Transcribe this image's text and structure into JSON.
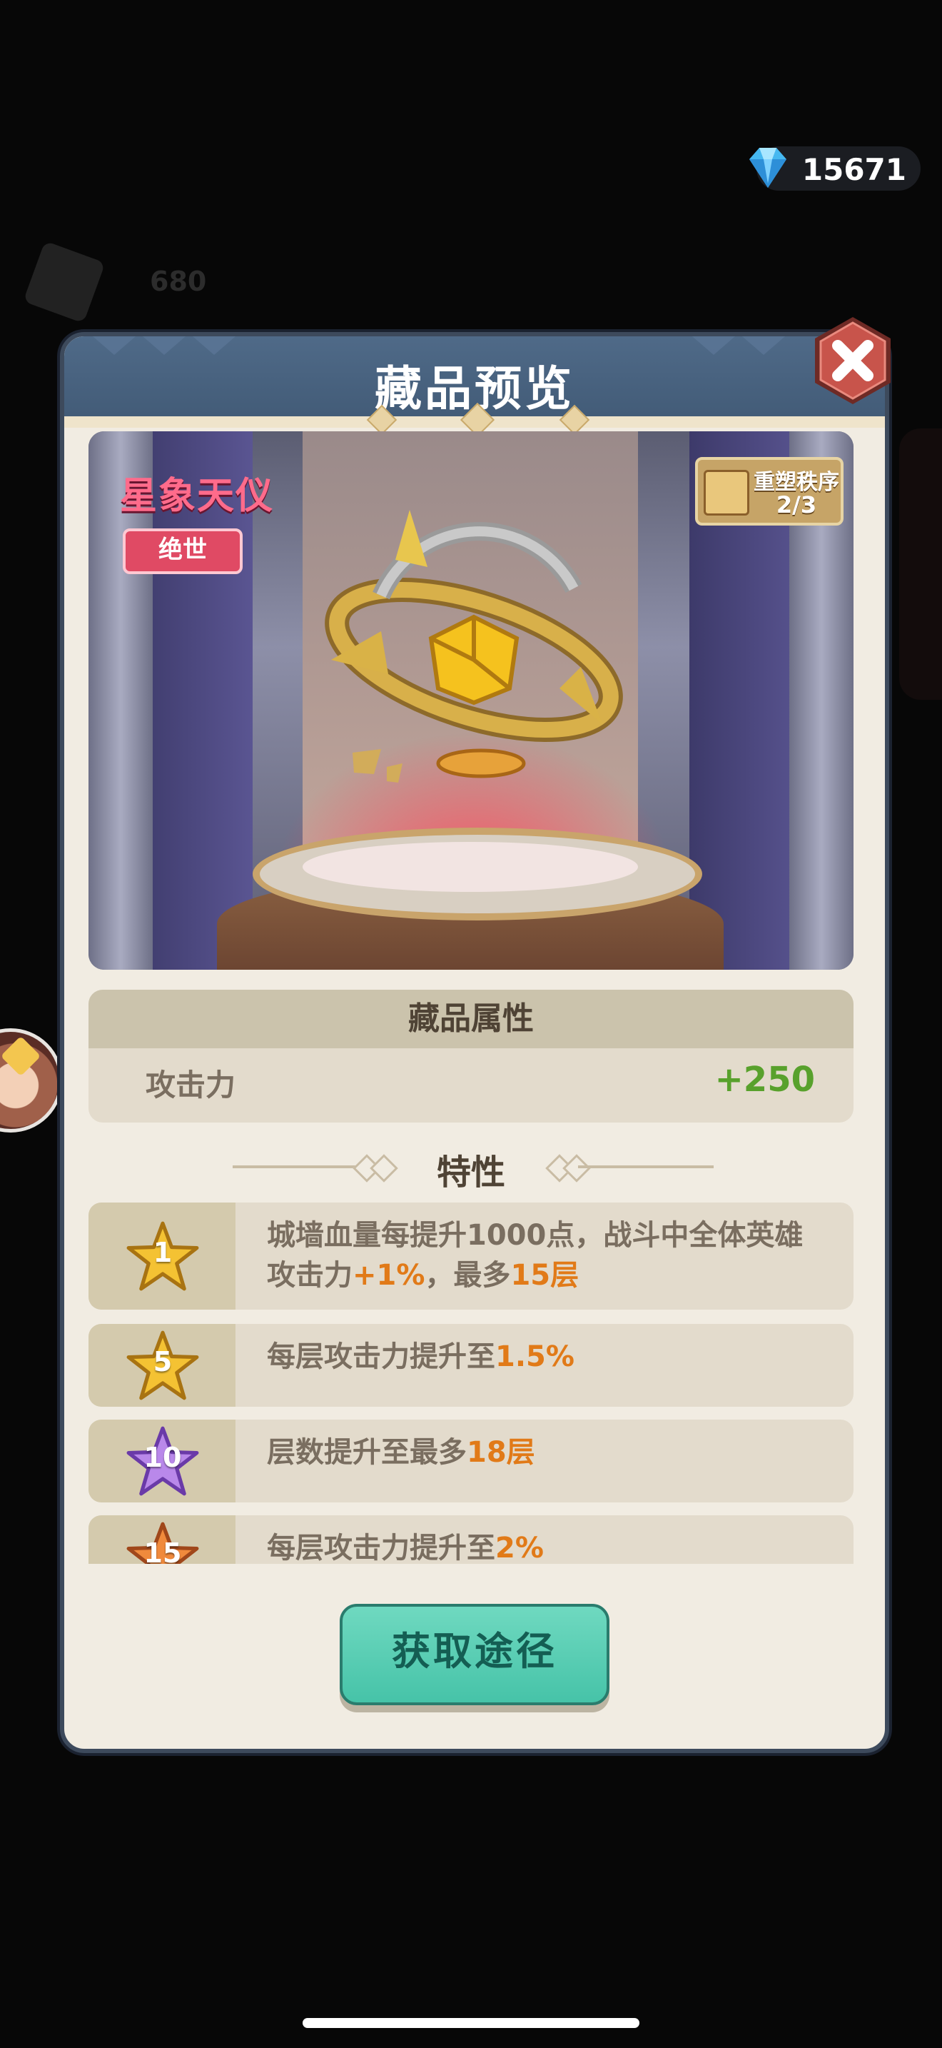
{
  "currency": {
    "icon": "diamond-icon",
    "value": "15671"
  },
  "background": {
    "counter_value": "680"
  },
  "modal": {
    "title": "藏品预览",
    "close_icon": "close-icon"
  },
  "item": {
    "name": "星象天仪",
    "rarity": "绝世",
    "reshape_label": "重塑秩序",
    "reshape_progress": "2/3"
  },
  "attributes": {
    "header": "藏品属性",
    "rows": [
      {
        "name": "攻击力",
        "value": "+250"
      }
    ]
  },
  "traits": {
    "title": "特性",
    "items": [
      {
        "level": "1",
        "star_color": "gold",
        "parts": [
          "城墙血量每提升1000点，战斗中全体英雄攻击力",
          "+1%",
          "，最多",
          "15层"
        ]
      },
      {
        "level": "5",
        "star_color": "gold",
        "parts": [
          "每层攻击力提升至",
          "1.5%"
        ]
      },
      {
        "level": "10",
        "star_color": "purple",
        "parts": [
          "层数提升至最多",
          "18层"
        ]
      },
      {
        "level": "15",
        "star_color": "orange",
        "parts": [
          "每层攻击力提升至",
          "2%"
        ]
      }
    ]
  },
  "actions": {
    "obtain_label": "获取途径"
  },
  "colors": {
    "highlight": "#e17a18",
    "attr_value": "#58a12c",
    "button": "#46c3a8"
  }
}
